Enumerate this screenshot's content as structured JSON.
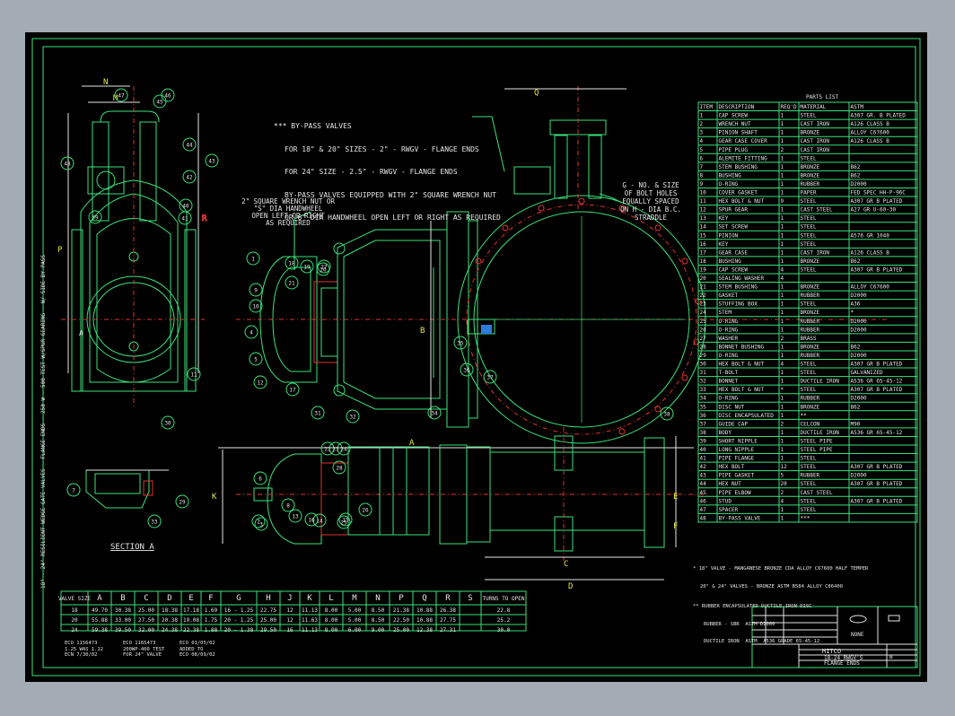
{
  "bypass_note": [
    "*** BY-PASS VALVES",
    "FOR 18\" & 20\" SIZES - 2\" - RWGV - FLANGE ENDS",
    "FOR 24\" SIZE - 2.5\" - RWGV - FLANGE ENDS",
    "BY-PASS VALVES EQUIPPED WITH 2\" SQUARE WRENCH NUT",
    "OR 6\" DIA HANDWHEEL OPEN LEFT OR RIGHT AS REQUIRED"
  ],
  "wrench_note": [
    "2\" SQUARE WRENCH NUT OR",
    "\"S\" DIA HANDWHEEL",
    "OPEN LEFT OR RIGHT",
    "AS REQUIRED"
  ],
  "bolt_note": [
    "G - NO. & SIZE",
    "OF BOLT HOLES",
    "EQUALLY SPACED",
    "ON H - DIA B.C.",
    "STRADDLE"
  ],
  "vertical_note": "18\" - 24\" RESILIENT WEDGE GATE VALVES - FLANGE ENDS - 250 W - 500 TEST W/SPUR GEARING - W/ SIDE BY-PASS",
  "section_label": "SECTION A",
  "dim_letters": [
    "A",
    "B",
    "C",
    "D",
    "E",
    "F",
    "G",
    "H",
    "J",
    "K",
    "L",
    "M",
    "N",
    "P",
    "Q",
    "R",
    "S"
  ],
  "balloons": [
    "1",
    "2",
    "3",
    "4",
    "5",
    "6",
    "7",
    "8",
    "9",
    "10",
    "11",
    "12",
    "13",
    "14",
    "15",
    "16",
    "17",
    "18",
    "19",
    "20",
    "21",
    "22",
    "23",
    "24",
    "25",
    "26",
    "27",
    "28",
    "29",
    "30",
    "31",
    "32",
    "33",
    "34",
    "35",
    "36",
    "37",
    "38",
    "39",
    "40",
    "41",
    "42",
    "43",
    "44",
    "45",
    "46",
    "47",
    "48"
  ],
  "parts_list": {
    "title": "PARTS LIST",
    "headers": [
      "ITEM",
      "DESCRIPTION",
      "REQ'D",
      "MATERIAL",
      "ASTM"
    ],
    "rows": [
      [
        "1",
        "CAP SCREW",
        "1",
        "STEEL",
        "A307  GR. B PLATED"
      ],
      [
        "2",
        "WRENCH NUT",
        "1",
        "CAST IRON",
        "A126 CLASS B"
      ],
      [
        "3",
        "PINION SHAFT",
        "1",
        "BRONZE",
        "ALLOY C67600"
      ],
      [
        "4",
        "GEAR CASE COVER",
        "1",
        "CAST IRON",
        "A126 CLASS B"
      ],
      [
        "5",
        "PIPE PLUG",
        "2",
        "CAST IRON",
        ""
      ],
      [
        "6",
        "ALEMITE FITTING",
        "1",
        "STEEL",
        ""
      ],
      [
        "7",
        "STEM BUSHING",
        "1",
        "BRONZE",
        "B62"
      ],
      [
        "8",
        "BUSHING",
        "1",
        "BRONZE",
        "B62"
      ],
      [
        "9",
        "O-RING",
        "1",
        "RUBBER",
        "D2000"
      ],
      [
        "10",
        "COVER GASKET",
        "1",
        "PAPER",
        "FED SPEC HH-P-96C"
      ],
      [
        "11",
        "HEX BOLT & NUT",
        "9",
        "STEEL",
        "A307  GR B PLATED"
      ],
      [
        "12",
        "SPUR GEAR",
        "1",
        "CAST STEEL",
        "A27  GR U-60-30"
      ],
      [
        "13",
        "KEY",
        "1",
        "STEEL",
        ""
      ],
      [
        "14",
        "SET SCREW",
        "1",
        "STEEL",
        ""
      ],
      [
        "15",
        "PINION",
        "1",
        "STEEL",
        "A576 GR 1040"
      ],
      [
        "16",
        "KEY",
        "1",
        "STEEL",
        ""
      ],
      [
        "17",
        "GEAR CASE",
        "1",
        "CAST IRON",
        "A126 CLASS B"
      ],
      [
        "18",
        "BUSHING",
        "1",
        "BRONZE",
        "B62"
      ],
      [
        "19",
        "CAP SCREW",
        "4",
        "STEEL",
        "A307  GR B PLATED"
      ],
      [
        "20",
        "SEALING WASHER",
        "4",
        "",
        ""
      ],
      [
        "21",
        "STEM BUSHING",
        "1",
        "BRONZE",
        "ALLOY C67600"
      ],
      [
        "22",
        "GASKET",
        "1",
        "RUBBER",
        "D2000"
      ],
      [
        "23",
        "STUFFING BOX",
        "1",
        "STEEL",
        "A36"
      ],
      [
        "24",
        "STEM",
        "1",
        "BRONZE",
        "*"
      ],
      [
        "25",
        "O-RING",
        "1",
        "RUBBER",
        "D2000"
      ],
      [
        "26",
        "O-RING",
        "1",
        "RUBBER",
        "D2000"
      ],
      [
        "27",
        "WASHER",
        "2",
        "BRASS",
        ""
      ],
      [
        "28",
        "BONNET BUSHING",
        "1",
        "BRONZE",
        "B62"
      ],
      [
        "29",
        "O-RING",
        "1",
        "RUBBER",
        "D2000"
      ],
      [
        "30",
        "HEX BOLT & NUT",
        "4",
        "STEEL",
        "A307  GR B PLATED"
      ],
      [
        "31",
        "T-BOLT",
        "1",
        "STEEL",
        "GALVANIZED"
      ],
      [
        "32",
        "BONNET",
        "1",
        "DUCTILE IRON",
        "A536  GR 65-45-12"
      ],
      [
        "33",
        "HEX BOLT & NUT",
        "*",
        "STEEL",
        "A307  GR B PLATED"
      ],
      [
        "34",
        "O-RING",
        "1",
        "RUBBER",
        "D2000"
      ],
      [
        "35",
        "DISC NUT",
        "1",
        "BRONZE",
        "B62"
      ],
      [
        "36",
        "DISC ENCAPSULATED",
        "1",
        "**",
        ""
      ],
      [
        "37",
        "GUIDE CAP",
        "2",
        "CELCON",
        "M90"
      ],
      [
        "38",
        "BODY",
        "1",
        "DUCTILE IRON",
        "A536  GR 65-45-12"
      ],
      [
        "39",
        "SHORT NIPPLE",
        "1",
        "STEEL PIPE",
        ""
      ],
      [
        "40",
        "LONG NIPPLE",
        "1",
        "STEEL PIPE",
        ""
      ],
      [
        "41",
        "PIPE FLANGE",
        "1",
        "STEEL",
        ""
      ],
      [
        "42",
        "HEX BOLT",
        "12",
        "STEEL",
        "A307  GR B PLATED"
      ],
      [
        "43",
        "PIPE GASKET",
        "5",
        "RUBBER",
        "D2000"
      ],
      [
        "44",
        "HEX NUT",
        "20",
        "STEEL",
        "A307  GR B PLATED"
      ],
      [
        "45",
        "PIPE ELBOW",
        "2",
        "CAST STEEL",
        ""
      ],
      [
        "46",
        "STUD",
        "4",
        "STEEL",
        "A307  GR B PLATED"
      ],
      [
        "47",
        "SPACER",
        "1",
        "STEEL",
        ""
      ],
      [
        "48",
        "BY-PASS VALVE",
        "1",
        "***",
        ""
      ]
    ]
  },
  "stem_notes": [
    "* 18\" VALVE - MANGANESE BRONZE CDA ALLOY C67600 HALF TEMPER",
    "20\" & 24\" VALVES - BRONZE ASTM B584 ALLOY C86400",
    "** RUBBER ENCAPSULATED DUCTILE IRON DISC",
    "RUBBER - SBR  ASTM D2000",
    "DUCTILE IRON  ASTM  A536 GRADE 65-45-12"
  ],
  "dimension_table": {
    "headers": [
      "VALVE SIZE",
      "A",
      "B",
      "C",
      "D",
      "E",
      "F",
      "G",
      "H",
      "J",
      "K",
      "L",
      "M",
      "N",
      "P",
      "Q",
      "R",
      "S",
      "TURNS TO OPEN"
    ],
    "rows": [
      [
        "18",
        "49.70",
        "30.38",
        "25.00",
        "18.38",
        "17.18",
        "1.69",
        "16 - 1.25",
        "22.75",
        "12",
        "11.13",
        "8.00",
        "5.00",
        "8.50",
        "21.38",
        "10.88",
        "26.38",
        "",
        "22.8"
      ],
      [
        "20",
        "55.88",
        "33.00",
        "27.50",
        "20.38",
        "19.08",
        "1.75",
        "20 - 1.25",
        "25.00",
        "12",
        "11.63",
        "8.00",
        "5.00",
        "8.50",
        "22.50",
        "10.88",
        "27.75",
        "",
        "25.2"
      ],
      [
        "24",
        "59.38",
        "39.50",
        "32.00",
        "24.38",
        "22.38",
        "1.88",
        "20 - 1.38",
        "29.50",
        "16",
        "11.13",
        "8.00",
        "6.00",
        "9.00",
        "25.00",
        "12.38",
        "27.31",
        "",
        "30.0"
      ]
    ]
  },
  "revision_notes": [
    [
      "ECO 1156473",
      "ECO 1165473",
      "ECO 01/05/02"
    ],
    [
      "1.25 WAS 1.12",
      "200WP-400 TEST",
      "ADDED TO"
    ],
    [
      "ECN 7/30/02",
      "FOR 24\" VALVE",
      "ECO 08/09/02"
    ]
  ],
  "title_block": {
    "company": "MITCO",
    "title": "18-24 RWGV'S",
    "subtitle": "FLANGE ENDS",
    "size": "B",
    "scale": "NONE"
  }
}
